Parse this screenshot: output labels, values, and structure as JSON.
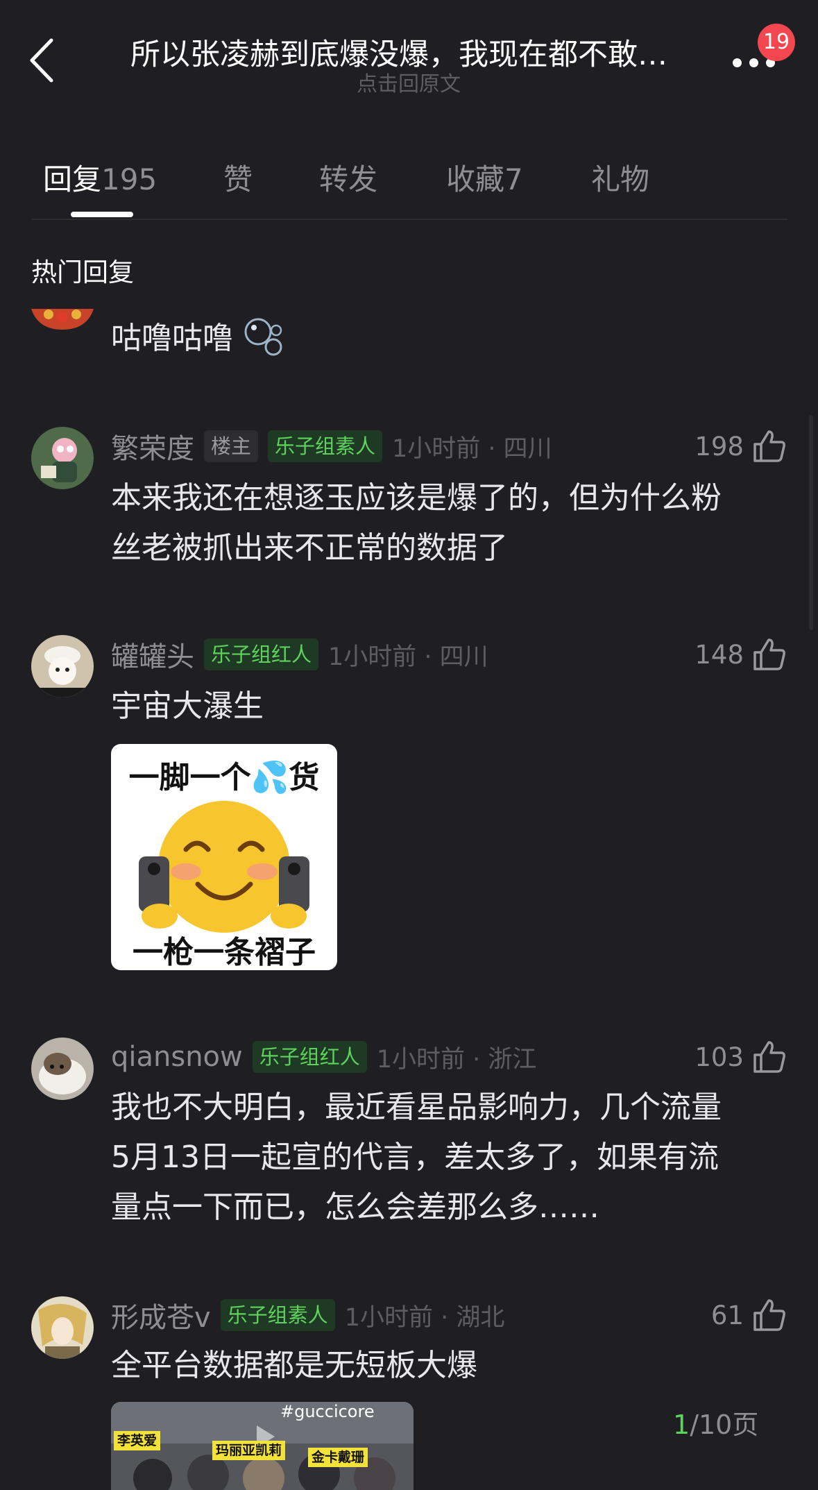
{
  "header": {
    "title": "所以张凌赫到底爆没爆，我现在都不敢…",
    "subtitle": "点击回原文",
    "badge_count": "19"
  },
  "tabs": [
    {
      "label": "回复",
      "count": "195",
      "active": true
    },
    {
      "label": "赞",
      "count": ""
    },
    {
      "label": "转发",
      "count": ""
    },
    {
      "label": "收藏",
      "count": "7"
    },
    {
      "label": "礼物",
      "count": ""
    }
  ],
  "section_title": "热门回复",
  "partial_comment": {
    "text": "咕噜咕噜"
  },
  "comments": [
    {
      "username": "繁荣度",
      "tags": [
        "楼主",
        "乐子组素人"
      ],
      "time_location": "1小时前 · 四川",
      "likes": "198",
      "text_lines": [
        "本来我还在想逐玉应该是爆了的，但为什么粉",
        "丝老被抓出来不正常的数据了"
      ]
    },
    {
      "username": "罐罐头",
      "tags": [
        "乐子组红人"
      ],
      "time_location": "1小时前 · 四川",
      "likes": "148",
      "text_lines": [
        "宇宙大瀑生"
      ],
      "sticker": {
        "top_text": "一脚一个💦货",
        "bottom_text": "一枪一条褶子"
      }
    },
    {
      "username": "qiansnow",
      "tags": [
        "乐子组红人"
      ],
      "time_location": "1小时前 · 浙江",
      "likes": "103",
      "text_lines": [
        "我也不大明白，最近看星品影响力，几个流量",
        "5月13日一起宣的代言，差太多了，如果有流",
        "量点一下而已，怎么会差那么多……"
      ]
    },
    {
      "username": "形成苍v",
      "tags": [
        "乐子组素人"
      ],
      "time_location": "1小时前 · 湖北",
      "likes": "61",
      "text_lines": [
        "全平台数据都是无短板大爆"
      ],
      "video": {
        "hashtag": "#guccicore",
        "names": [
          "李英爱",
          "玛丽亚凯莉",
          "金卡戴珊"
        ]
      }
    }
  ],
  "pager": {
    "current": "1",
    "total": "/10页"
  },
  "colors": {
    "background": "#1f1f23",
    "accent_green": "#5fd15d",
    "badge_red": "#f2474f"
  }
}
